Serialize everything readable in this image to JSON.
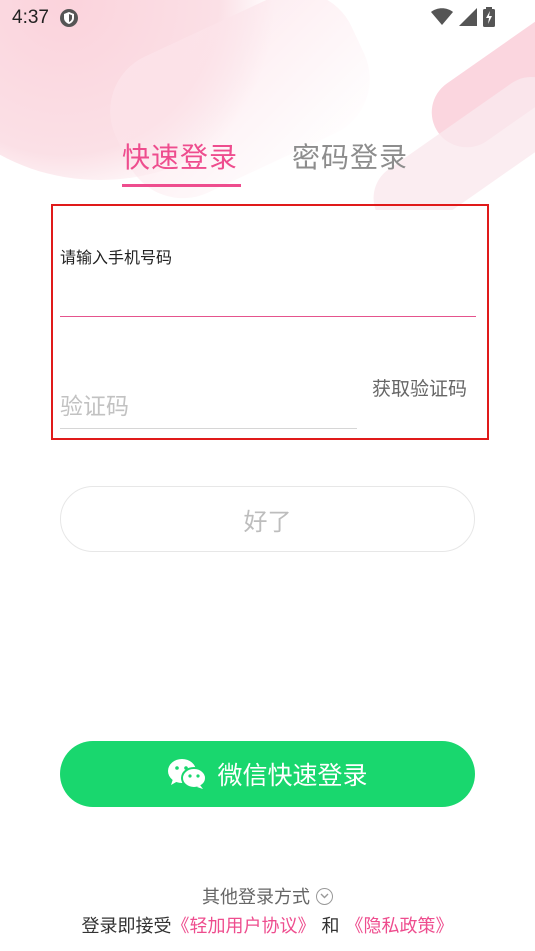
{
  "status_bar": {
    "time": "4:37"
  },
  "tabs": {
    "quick_login": "快速登录",
    "password_login": "密码登录"
  },
  "form": {
    "phone_placeholder": "请输入手机号码",
    "phone_value": "",
    "code_placeholder": "验证码",
    "code_value": "",
    "get_code_label": "获取验证码"
  },
  "confirm_button": {
    "label": "好了"
  },
  "wechat": {
    "label": "微信快速登录",
    "color": "#19d76e"
  },
  "other_login": {
    "label": "其他登录方式"
  },
  "agreement": {
    "prefix": "登录即接受",
    "user_agreement": "《轻加用户协议》",
    "and": "和",
    "privacy_policy": "《隐私政策》"
  },
  "colors": {
    "accent": "#ee4d8e",
    "highlight_box": "#e01a1a"
  }
}
